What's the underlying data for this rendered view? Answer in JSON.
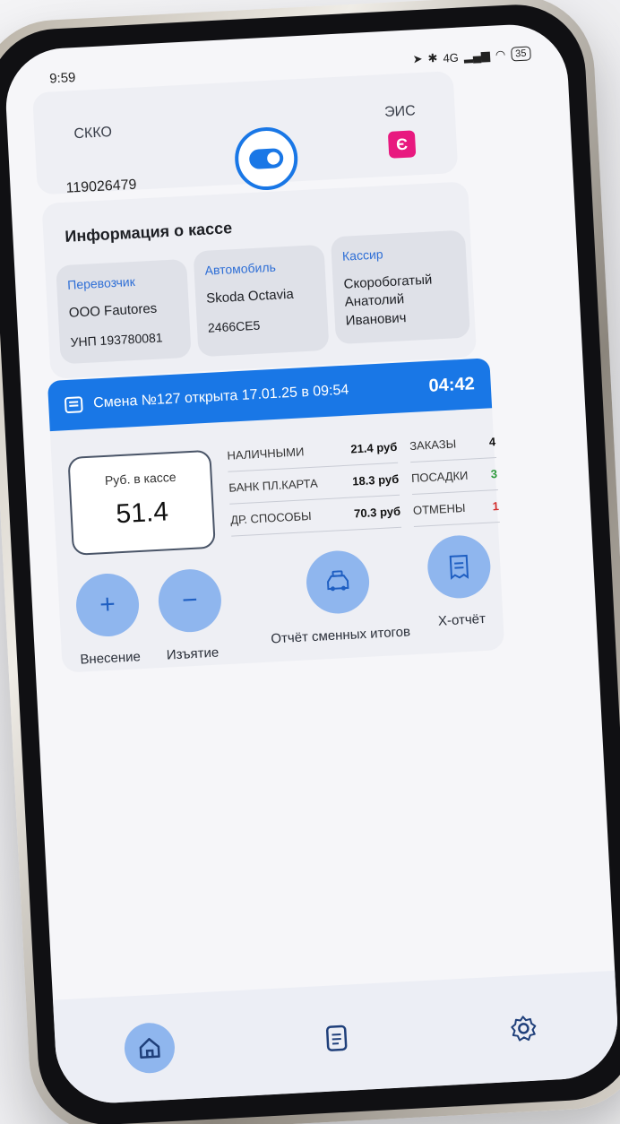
{
  "status_bar": {
    "time": "9:59",
    "network": "4G",
    "battery": "35"
  },
  "top": {
    "skko_label": "СККО",
    "skko_number": "119026479",
    "eis_label": "ЭИС"
  },
  "register_info": {
    "title": "Информация о кассе",
    "carrier": {
      "label": "Перевозчик",
      "name": "ООО Fautores",
      "unp": "УНП 193780081"
    },
    "vehicle": {
      "label": "Автомобиль",
      "model": "Skoda Octavia",
      "plate": "2466CE5"
    },
    "cashier": {
      "label": "Кассир",
      "name": "Скоробогатый Анатолий Иванович"
    }
  },
  "shift": {
    "title": "Смена №127 открыта 17.01.25 в 09:54",
    "timer": "04:42",
    "cash_label": "Руб. в кассе",
    "cash_value": "51.4",
    "payments": [
      {
        "label": "НАЛИЧНЫМИ",
        "amount": "21.4 руб"
      },
      {
        "label": "БАНК ПЛ.КАРТА",
        "amount": "18.3 руб"
      },
      {
        "label": "ДР. СПОСОБЫ",
        "amount": "70.3 руб"
      }
    ],
    "counts": [
      {
        "label": "ЗАКАЗЫ",
        "value": "4"
      },
      {
        "label": "ПОСАДКИ",
        "value": "3"
      },
      {
        "label": "ОТМЕНЫ",
        "value": "1"
      }
    ],
    "count_colors": [
      "#111111",
      "#2e9a3c",
      "#d3302f"
    ]
  },
  "actions": {
    "deposit": "Внесение",
    "withdraw": "Изъятие",
    "shift_report": "Отчёт сменных итогов",
    "x_report": "Х-отчёт"
  },
  "colors": {
    "primary": "#1977e6",
    "action_bg": "#8fb6ee",
    "eis_brand": "#e8197f"
  }
}
